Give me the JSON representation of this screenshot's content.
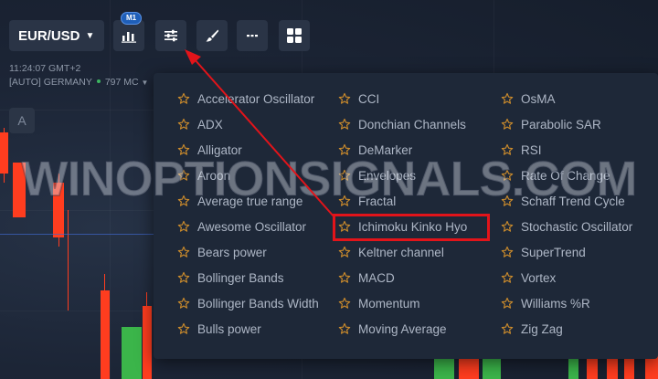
{
  "toolbar": {
    "asset_label": "EUR/USD",
    "timeframe_badge": "M1"
  },
  "info": {
    "time": "11:24:07 GMT+2",
    "region": "[AUTO] GERMANY",
    "ping": "797 MC"
  },
  "chart_toolbar": {
    "a_label": "A"
  },
  "indicators": {
    "columns": [
      [
        "Accelerator Oscillator",
        "ADX",
        "Alligator",
        "Aroon",
        "Average true range",
        "Awesome Oscillator",
        "Bears power",
        "Bollinger Bands",
        "Bollinger Bands Width",
        "Bulls power"
      ],
      [
        "CCI",
        "Donchian Channels",
        "DeMarker",
        "Envelopes",
        "Fractal",
        "Ichimoku Kinko Hyo",
        "Keltner channel",
        "MACD",
        "Momentum",
        "Moving Average"
      ],
      [
        "OsMA",
        "Parabolic SAR",
        "RSI",
        "Rate Of Change",
        "Schaff Trend Cycle",
        "Stochastic Oscillator",
        "SuperTrend",
        "Vortex",
        "Williams %R",
        "Zig Zag"
      ]
    ],
    "highlighted": "Ichimoku Kinko Hyo"
  },
  "watermark": "WINOPTIONSIGNALS.COM",
  "colors": {
    "star": "#c98a2c",
    "highlight": "#e2141a",
    "bull": "#3bb54a",
    "bear": "#ff3d1f"
  }
}
